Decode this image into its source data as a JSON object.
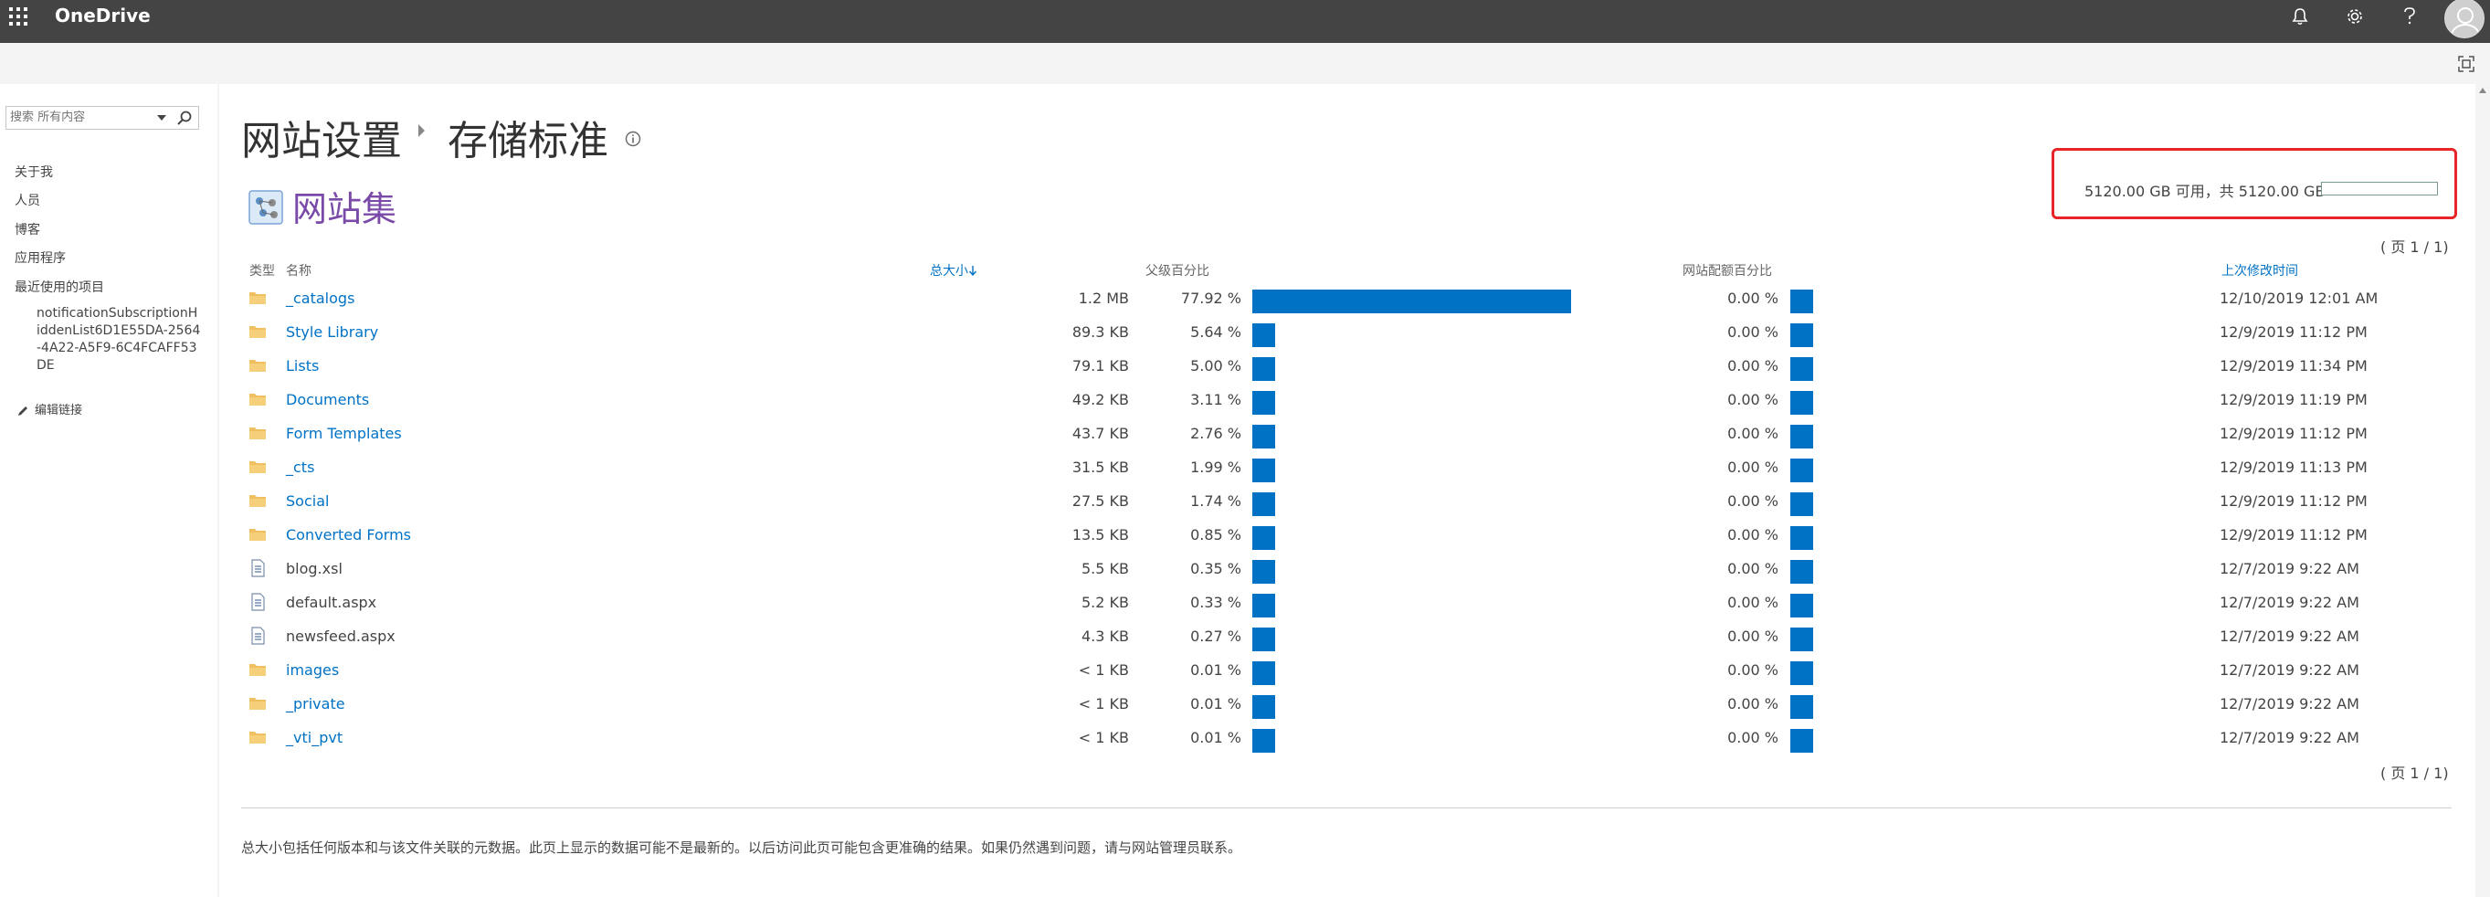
{
  "suite": {
    "brand": "OneDrive",
    "icons": [
      "waffle-icon",
      "bell-icon",
      "gear-icon",
      "help-icon",
      "avatar-icon"
    ]
  },
  "nav": {
    "search_placeholder": "搜索 所有内容",
    "items": [
      "关于我",
      "人员",
      "博客",
      "应用程序",
      "最近使用的项目"
    ],
    "recent_item": "notificationSubscriptionHiddenList6D1E55DA-2564-4A22-A5F9-6C4FCAFF53DE",
    "edit_links": "编辑链接"
  },
  "page": {
    "breadcrumb_parent": "网站设置",
    "breadcrumb_current": "存储标准",
    "collection_title": "网站集",
    "quota_text": "5120.00 GB 可用，共 5120.00 GB",
    "quota_used_fraction": 0,
    "paging_top": "( 页 1 / 1)",
    "paging_bottom": "( 页 1 / 1)",
    "footer_note": "总大小包括任何版本和与该文件关联的元数据。此页上显示的数据可能不是最新的。以后访问此页可能包含更准确的结果。如果仍然遇到问题，请与网站管理员联系。"
  },
  "table": {
    "headers": {
      "type": "类型",
      "name": "名称",
      "total_size": "总大小",
      "parent_pct": "父级百分比",
      "quota_pct": "网站配额百分比",
      "modified": "上次修改时间"
    },
    "rows": [
      {
        "type": "folder",
        "name": "_catalogs",
        "size": "1.2 MB",
        "pct": "77.92 %",
        "pct_value": 77.92,
        "qpct": "0.00 %",
        "date": "12/10/2019 12:01 AM"
      },
      {
        "type": "folder",
        "name": "Style Library",
        "size": "89.3 KB",
        "pct": "5.64 %",
        "pct_value": 5.64,
        "qpct": "0.00 %",
        "date": "12/9/2019 11:12 PM"
      },
      {
        "type": "folder",
        "name": "Lists",
        "size": "79.1 KB",
        "pct": "5.00 %",
        "pct_value": 5.0,
        "qpct": "0.00 %",
        "date": "12/9/2019 11:34 PM"
      },
      {
        "type": "folder",
        "name": "Documents",
        "size": "49.2 KB",
        "pct": "3.11 %",
        "pct_value": 3.11,
        "qpct": "0.00 %",
        "date": "12/9/2019 11:19 PM"
      },
      {
        "type": "folder",
        "name": "Form Templates",
        "size": "43.7 KB",
        "pct": "2.76 %",
        "pct_value": 2.76,
        "qpct": "0.00 %",
        "date": "12/9/2019 11:12 PM"
      },
      {
        "type": "folder",
        "name": "_cts",
        "size": "31.5 KB",
        "pct": "1.99 %",
        "pct_value": 1.99,
        "qpct": "0.00 %",
        "date": "12/9/2019 11:13 PM"
      },
      {
        "type": "folder",
        "name": "Social",
        "size": "27.5 KB",
        "pct": "1.74 %",
        "pct_value": 1.74,
        "qpct": "0.00 %",
        "date": "12/9/2019 11:12 PM"
      },
      {
        "type": "folder",
        "name": "Converted Forms",
        "size": "13.5 KB",
        "pct": "0.85 %",
        "pct_value": 0.85,
        "qpct": "0.00 %",
        "date": "12/9/2019 11:12 PM"
      },
      {
        "type": "file",
        "name": "blog.xsl",
        "size": "5.5 KB",
        "pct": "0.35 %",
        "pct_value": 0.35,
        "qpct": "0.00 %",
        "date": "12/7/2019 9:22 AM"
      },
      {
        "type": "file",
        "name": "default.aspx",
        "size": "5.2 KB",
        "pct": "0.33 %",
        "pct_value": 0.33,
        "qpct": "0.00 %",
        "date": "12/7/2019 9:22 AM"
      },
      {
        "type": "file",
        "name": "newsfeed.aspx",
        "size": "4.3 KB",
        "pct": "0.27 %",
        "pct_value": 0.27,
        "qpct": "0.00 %",
        "date": "12/7/2019 9:22 AM"
      },
      {
        "type": "folder",
        "name": "images",
        "size": "< 1 KB",
        "pct": "0.01 %",
        "pct_value": 0.01,
        "qpct": "0.00 %",
        "date": "12/7/2019 9:22 AM"
      },
      {
        "type": "folder",
        "name": "_private",
        "size": "< 1 KB",
        "pct": "0.01 %",
        "pct_value": 0.01,
        "qpct": "0.00 %",
        "date": "12/7/2019 9:22 AM"
      },
      {
        "type": "folder",
        "name": "_vti_pvt",
        "size": "< 1 KB",
        "pct": "0.01 %",
        "pct_value": 0.01,
        "qpct": "0.00 %",
        "date": "12/7/2019 9:22 AM"
      }
    ]
  },
  "colors": {
    "suite_bar": "#444444",
    "bar_blue": "#0072c6",
    "link_blue": "#0072c6",
    "title_purple": "#7a4aa8",
    "highlight_red": "#e8262a",
    "folder": "#f0c060"
  }
}
